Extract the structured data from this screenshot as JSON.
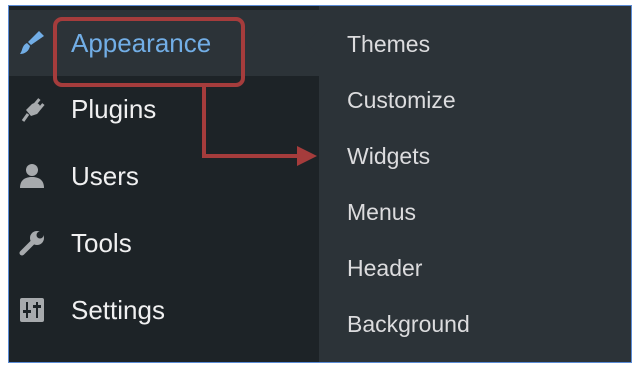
{
  "sidebar": {
    "items": [
      {
        "label": "Appearance",
        "icon": "paintbrush-icon",
        "active": true
      },
      {
        "label": "Plugins",
        "icon": "plug-icon"
      },
      {
        "label": "Users",
        "icon": "user-icon"
      },
      {
        "label": "Tools",
        "icon": "wrench-icon"
      },
      {
        "label": "Settings",
        "icon": "settings-sliders-icon"
      }
    ]
  },
  "submenu": {
    "items": [
      {
        "label": "Themes"
      },
      {
        "label": "Customize"
      },
      {
        "label": "Widgets"
      },
      {
        "label": "Menus"
      },
      {
        "label": "Header"
      },
      {
        "label": "Background"
      }
    ]
  },
  "colors": {
    "sidebar_bg": "#1d2327",
    "submenu_bg": "#2c3338",
    "active_text": "#72aee6",
    "highlight": "#a53c3c"
  }
}
